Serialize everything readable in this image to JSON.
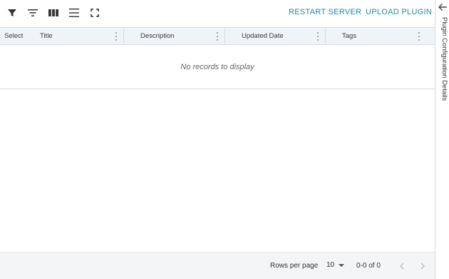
{
  "toolbar": {
    "icons": [
      "filter-icon",
      "sort-icon",
      "columns-icon",
      "density-icon",
      "fullscreen-icon"
    ],
    "restart_label": "RESTART SERVER",
    "upload_label": "UPLOAD PLUGIN"
  },
  "table": {
    "columns": [
      "Select",
      "Title",
      "Description",
      "Updated Date",
      "Tags"
    ],
    "empty_message": "No records to display"
  },
  "footer": {
    "rows_per_page_label": "Rows per page",
    "rows_per_page_value": "10",
    "range_text": "0-0 of 0"
  },
  "side_panel": {
    "label": "Plugin Configuration Details"
  },
  "colors": {
    "accent": "#1e8aa0",
    "header_bg": "#eef4f8",
    "footer_bg": "#f3f5f7"
  }
}
